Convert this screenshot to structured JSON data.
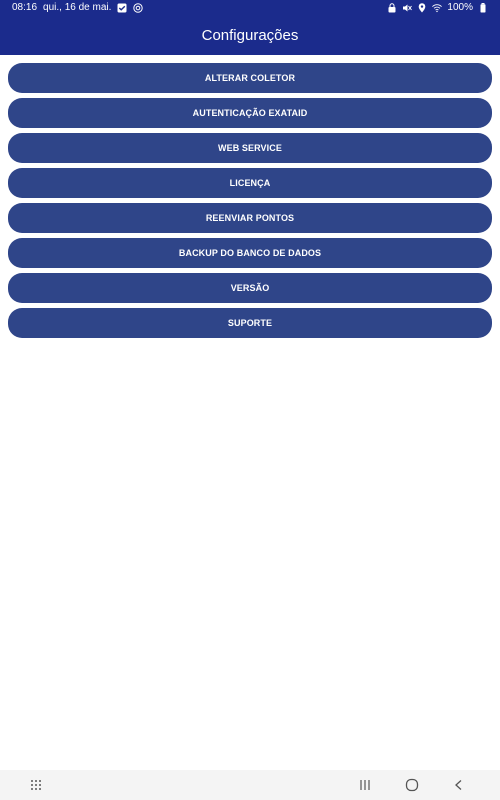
{
  "status_bar": {
    "time": "08:16",
    "date": "qui., 16 de mai.",
    "battery": "100%"
  },
  "app_bar": {
    "title": "Configurações"
  },
  "menu": {
    "items": [
      {
        "label": "ALTERAR COLETOR"
      },
      {
        "label": "AUTENTICAÇÃO EXATAID"
      },
      {
        "label": "WEB SERVICE"
      },
      {
        "label": "LICENÇA"
      },
      {
        "label": "REENVIAR PONTOS"
      },
      {
        "label": "BACKUP DO BANCO DE DADOS"
      },
      {
        "label": "VERSÃO"
      },
      {
        "label": "SUPORTE"
      }
    ]
  },
  "colors": {
    "appbar": "#1b2b8c",
    "button": "#2f4589",
    "background": "#ffffff",
    "navbar": "#f4f4f4"
  },
  "icons": {
    "status_left": [
      "checkbox-icon",
      "at-sign-icon"
    ],
    "status_right": [
      "lock-icon",
      "mute-icon",
      "location-icon",
      "wifi-icon",
      "battery-icon"
    ],
    "nav": [
      "apps-grid-icon",
      "recents-icon",
      "home-icon",
      "back-icon"
    ]
  }
}
